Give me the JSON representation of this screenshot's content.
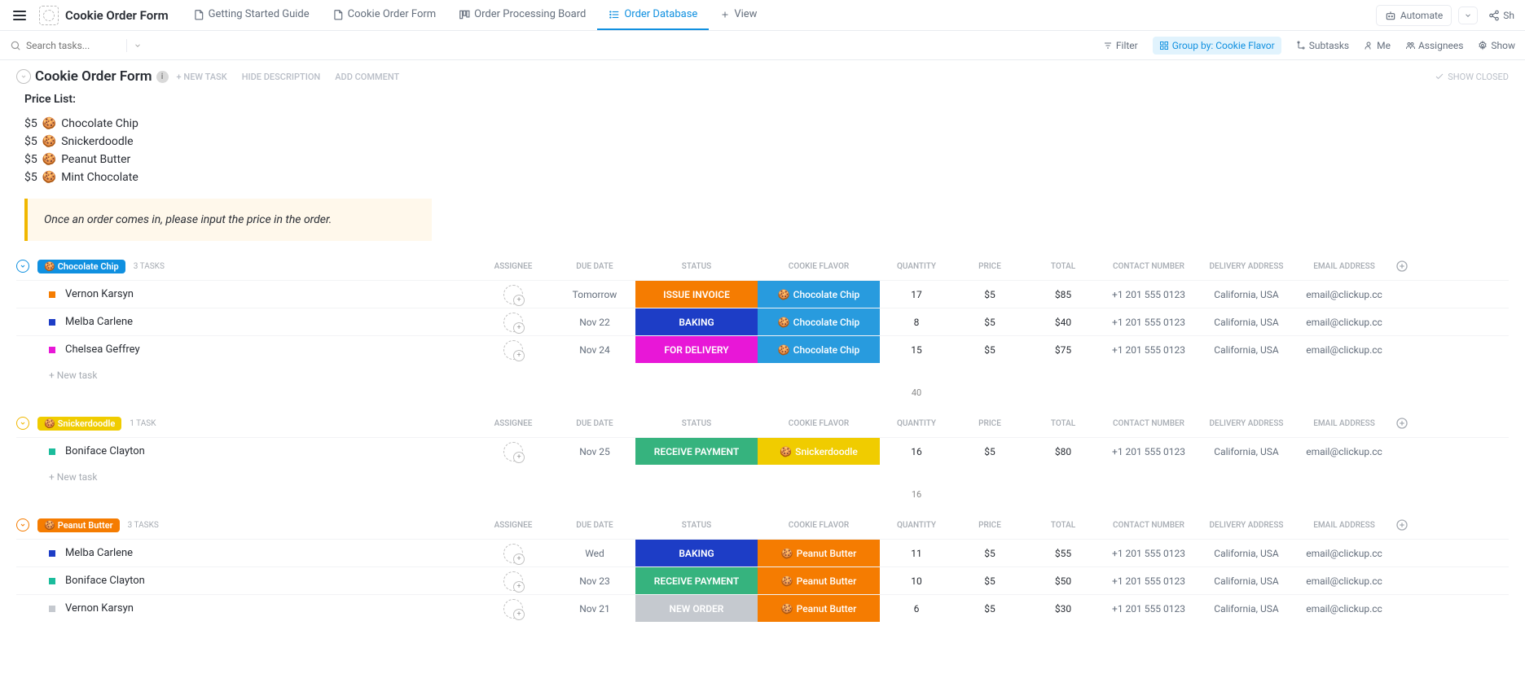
{
  "topNav": {
    "spaceName": "Cookie Order Form",
    "tabs": [
      {
        "label": "Getting Started Guide",
        "iconName": "doc-icon"
      },
      {
        "label": "Cookie Order Form",
        "iconName": "doc-icon"
      },
      {
        "label": "Order Processing Board",
        "iconName": "board-icon"
      },
      {
        "label": "Order Database",
        "iconName": "list-icon",
        "active": true
      },
      {
        "label": "View",
        "iconName": "plus-icon"
      }
    ],
    "automate": "Automate",
    "share": "Sh"
  },
  "toolbar": {
    "searchPlaceholder": "Search tasks...",
    "filter": "Filter",
    "groupBy": "Group by: Cookie Flavor",
    "subtasks": "Subtasks",
    "me": "Me",
    "assignees": "Assignees",
    "show": "Show"
  },
  "pageHeader": {
    "title": "Cookie Order Form",
    "newTask": "+ NEW TASK",
    "hideDescription": "HIDE DESCRIPTION",
    "addComment": "ADD COMMENT",
    "showClosed": "SHOW CLOSED"
  },
  "description": {
    "heading": "Price List:",
    "items": [
      {
        "price": "$5",
        "label": "Chocolate Chip"
      },
      {
        "price": "$5",
        "label": "Snickerdoodle"
      },
      {
        "price": "$5",
        "label": "Peanut Butter"
      },
      {
        "price": "$5",
        "label": "Mint Chocolate"
      }
    ],
    "note": "Once an order comes in, please input the price in the order."
  },
  "columns": {
    "assignee": "ASSIGNEE",
    "dueDate": "DUE DATE",
    "status": "STATUS",
    "cookieFlavor": "COOKIE FLAVOR",
    "quantity": "QUANTITY",
    "price": "PRICE",
    "total": "TOTAL",
    "contactNumber": "CONTACT NUMBER",
    "deliveryAddress": "DELIVERY ADDRESS",
    "emailAddress": "EMAIL ADDRESS"
  },
  "newTaskLabel": "+ New task",
  "groups": [
    {
      "label": "Chocolate Chip",
      "badgeClass": "blue",
      "taskCount": "3 TASKS",
      "rows": [
        {
          "priorityColor": "#f57c01",
          "name": "Vernon Karsyn",
          "dueDate": "Tomorrow",
          "status": "ISSUE INVOICE",
          "statusClass": "status-issue-invoice",
          "flavor": "Chocolate Chip",
          "flavorClass": "flavor-chocolate-chip",
          "quantity": "17",
          "price": "$5",
          "total": "$85",
          "contact": "+1 201 555 0123",
          "address": "California, USA",
          "email": "email@clickup.cc"
        },
        {
          "priorityColor": "#1d3dc6",
          "name": "Melba Carlene",
          "dueDate": "Nov 22",
          "status": "BAKING",
          "statusClass": "status-baking",
          "flavor": "Chocolate Chip",
          "flavorClass": "flavor-chocolate-chip",
          "quantity": "8",
          "price": "$5",
          "total": "$40",
          "contact": "+1 201 555 0123",
          "address": "California, USA",
          "email": "email@clickup.cc"
        },
        {
          "priorityColor": "#e817d7",
          "name": "Chelsea Geffrey",
          "dueDate": "Nov 24",
          "status": "FOR DELIVERY",
          "statusClass": "status-for-delivery",
          "flavor": "Chocolate Chip",
          "flavorClass": "flavor-chocolate-chip",
          "quantity": "15",
          "price": "$5",
          "total": "$75",
          "contact": "+1 201 555 0123",
          "address": "California, USA",
          "email": "email@clickup.cc"
        }
      ],
      "sum": "40",
      "showNewTask": true
    },
    {
      "label": "Snickerdoodle",
      "badgeClass": "yellow",
      "taskCount": "1 TASK",
      "rows": [
        {
          "priorityColor": "#1bbc9c",
          "name": "Boniface Clayton",
          "dueDate": "Nov 25",
          "status": "RECEIVE PAYMENT",
          "statusClass": "status-receive-payment",
          "flavor": "Snickerdoodle",
          "flavorClass": "flavor-snickerdoodle",
          "quantity": "16",
          "price": "$5",
          "total": "$80",
          "contact": "+1 201 555 0123",
          "address": "California, USA",
          "email": "email@clickup.cc"
        }
      ],
      "sum": "16",
      "showNewTask": true
    },
    {
      "label": "Peanut Butter",
      "badgeClass": "orange",
      "taskCount": "3 TASKS",
      "rows": [
        {
          "priorityColor": "#1d3dc6",
          "name": "Melba Carlene",
          "dueDate": "Wed",
          "status": "BAKING",
          "statusClass": "status-baking",
          "flavor": "Peanut Butter",
          "flavorClass": "flavor-peanut-butter",
          "quantity": "11",
          "price": "$5",
          "total": "$55",
          "contact": "+1 201 555 0123",
          "address": "California, USA",
          "email": "email@clickup.cc"
        },
        {
          "priorityColor": "#1bbc9c",
          "name": "Boniface Clayton",
          "dueDate": "Nov 23",
          "status": "RECEIVE PAYMENT",
          "statusClass": "status-receive-payment",
          "flavor": "Peanut Butter",
          "flavorClass": "flavor-peanut-butter",
          "quantity": "10",
          "price": "$5",
          "total": "$50",
          "contact": "+1 201 555 0123",
          "address": "California, USA",
          "email": "email@clickup.cc"
        },
        {
          "priorityColor": "#c5c9cf",
          "name": "Vernon Karsyn",
          "dueDate": "Nov 21",
          "status": "NEW ORDER",
          "statusClass": "status-new-order",
          "flavor": "Peanut Butter",
          "flavorClass": "flavor-peanut-butter",
          "quantity": "6",
          "price": "$5",
          "total": "$30",
          "contact": "+1 201 555 0123",
          "address": "California, USA",
          "email": "email@clickup.cc"
        }
      ],
      "sum": "",
      "showNewTask": false
    }
  ]
}
